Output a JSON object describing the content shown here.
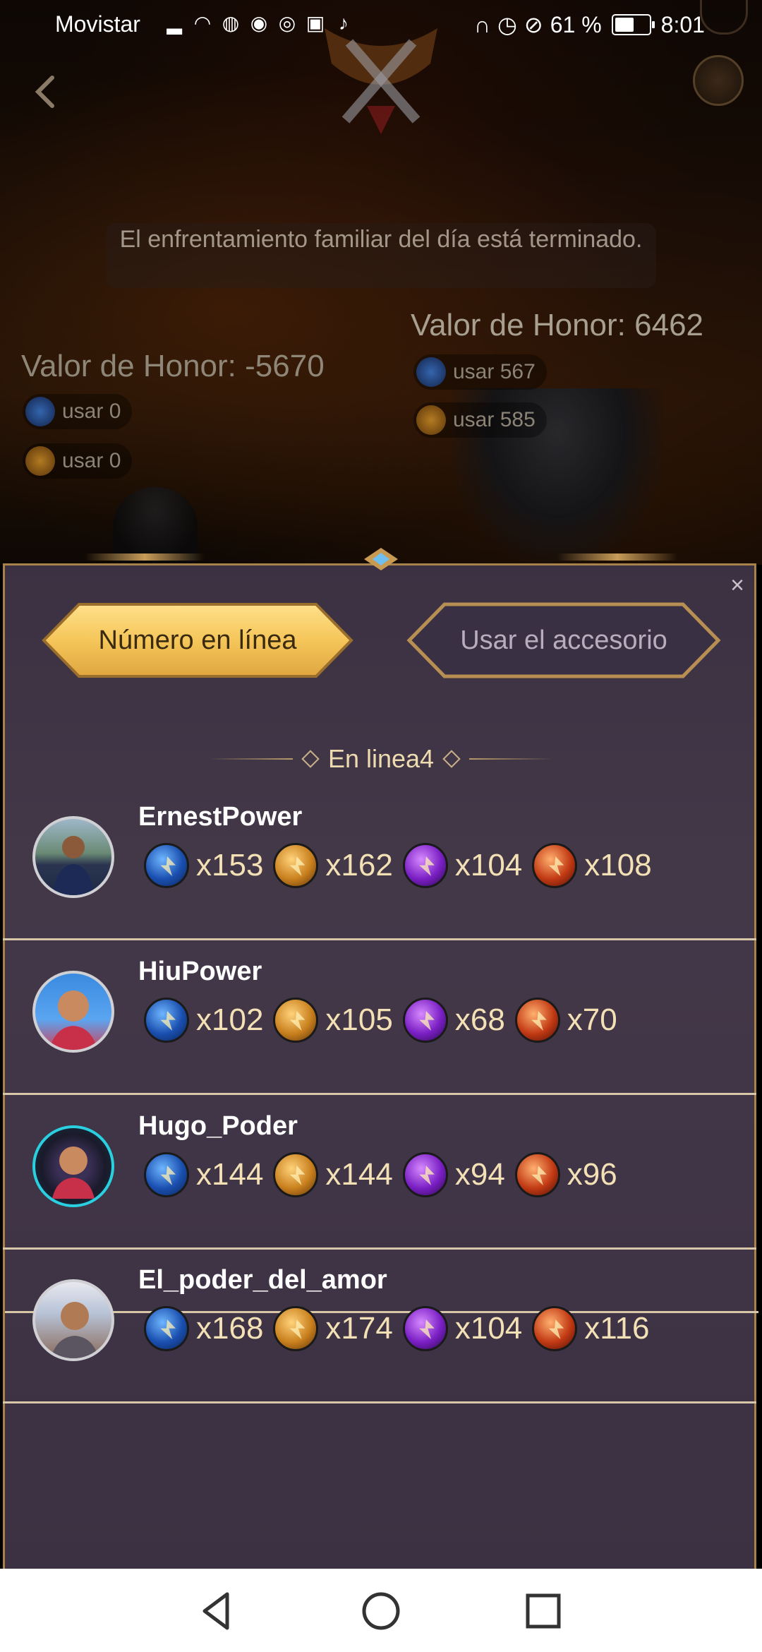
{
  "status_bar": {
    "carrier": "Movistar",
    "battery_text": "61 %",
    "battery_level": 0.61,
    "time": "8:01"
  },
  "scene": {
    "notice": "El enfrentamiento familiar del día está terminado.",
    "honor_left": "Valor de Honor: -5670",
    "honor_right": "Valor de Honor: 6462",
    "left_usage": [
      "usar 0",
      "usar 0"
    ],
    "right_usage": [
      "usar 567",
      "usar 585"
    ]
  },
  "tabs": {
    "online": "Número en línea",
    "accessory": "Usar el accesorio"
  },
  "section_title": "En linea4",
  "players": [
    {
      "name": "ErnestPower",
      "items": [
        "x153",
        "x162",
        "x104",
        "x108"
      ]
    },
    {
      "name": "HiuPower",
      "items": [
        "x102",
        "x105",
        "x68",
        "x70"
      ]
    },
    {
      "name": "Hugo_Poder",
      "items": [
        "x144",
        "x144",
        "x94",
        "x96"
      ]
    },
    {
      "name": "El_poder_del_amor",
      "items": [
        "x168",
        "x174",
        "x104",
        "x116"
      ]
    }
  ],
  "item_icons": [
    "blue-orb-icon",
    "gold-orb-icon",
    "purple-orb-icon",
    "red-orb-icon"
  ],
  "colors": {
    "panel_bg": "#3f3446",
    "panel_border": "#a8824a",
    "gold_tab": "#f5c65a",
    "quantity_text": "#f3e1b5",
    "section_title": "#eedbb0"
  }
}
